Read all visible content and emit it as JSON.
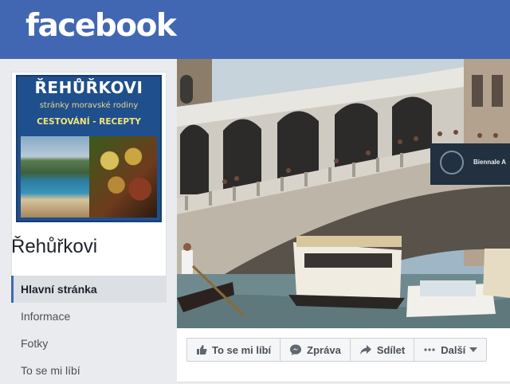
{
  "brand": {
    "logo_text": "facebook"
  },
  "profile": {
    "image_title": "ŘEHŮŘKOVI",
    "image_subtitle": "stránky moravské rodiny",
    "image_tagline": "CESTOVÁNÍ - RECEPTY",
    "page_name": "Řehůřkovi"
  },
  "nav": {
    "items": [
      {
        "label": "Hlavní stránka",
        "active": true
      },
      {
        "label": "Informace"
      },
      {
        "label": "Fotky"
      },
      {
        "label": "To se mi líbí"
      }
    ]
  },
  "cover": {
    "banner_text": "Biennale A"
  },
  "actions": {
    "like_label": "To se mi líbí",
    "message_label": "Zpráva",
    "share_label": "Sdílet",
    "more_label": "Další"
  },
  "colors": {
    "brand_blue": "#4267b2",
    "background": "#e9ebee"
  },
  "icons": [
    "thumbs-up-icon",
    "message-bubble-icon",
    "share-arrow-icon",
    "more-dots-icon",
    "caret-down-icon"
  ]
}
